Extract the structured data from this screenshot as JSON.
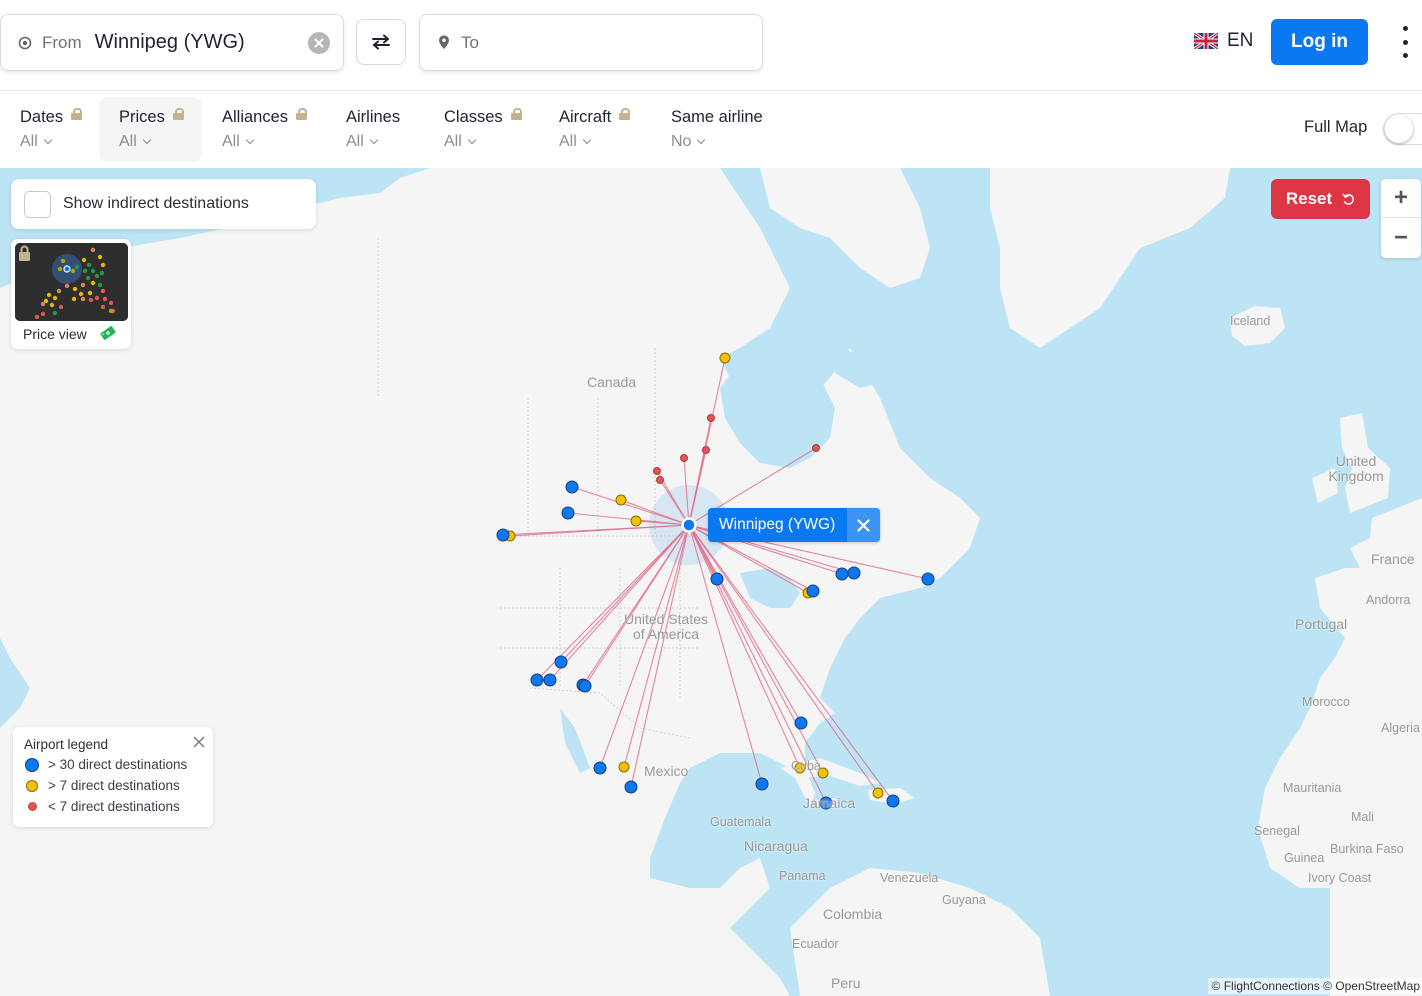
{
  "search": {
    "from_label": "From",
    "from_value": "Winnipeg (YWG)",
    "to_placeholder": "To"
  },
  "header": {
    "language": "EN",
    "login_label": "Log in"
  },
  "filters": [
    {
      "label": "Dates",
      "value": "All",
      "locked": true
    },
    {
      "label": "Prices",
      "value": "All",
      "locked": true,
      "active": true
    },
    {
      "label": "Alliances",
      "value": "All",
      "locked": true
    },
    {
      "label": "Airlines",
      "value": "All",
      "locked": false
    },
    {
      "label": "Classes",
      "value": "All",
      "locked": true
    },
    {
      "label": "Aircraft",
      "value": "All",
      "locked": true
    },
    {
      "label": "Same airline",
      "value": "No",
      "locked": false
    }
  ],
  "full_map": {
    "label": "Full Map",
    "enabled": false
  },
  "map": {
    "indirect_label": "Show indirect destinations",
    "indirect_checked": false,
    "price_view_label": "Price view",
    "reset_label": "Reset",
    "zoom_in": "+",
    "zoom_out": "−",
    "selected_airport": "Winnipeg (YWG)",
    "attribution": "© FlightConnections © OpenStreetMap",
    "country_labels": [
      "Canada",
      "United States of America",
      "Mexico",
      "Cuba",
      "Jamaica",
      "Guatemala",
      "Nicaragua",
      "Panama",
      "Venezuela",
      "Guyana",
      "Colombia",
      "Ecuador",
      "Peru",
      "Iceland",
      "United Kingdom",
      "France",
      "Andorra",
      "Portugal",
      "Morocco",
      "Algeria",
      "Mauritania",
      "Mali",
      "Senegal",
      "Burkina Faso",
      "Guinea",
      "Ivory Coast"
    ]
  },
  "legend": {
    "title": "Airport legend",
    "items": [
      {
        "label": "> 30 direct destinations",
        "color": "#0a78f0",
        "size": "large"
      },
      {
        "label": "> 7 direct destinations",
        "color": "#f5c000",
        "size": "medium"
      },
      {
        "label": "< 7 direct destinations",
        "color": "#e05555",
        "size": "small"
      }
    ]
  },
  "colors": {
    "accent": "#0a78f0",
    "reset": "#dc3545",
    "route_line": "#e0708a",
    "water": "#bde4f4",
    "land": "#f5f5f5"
  },
  "destinations": [
    {
      "type": "large"
    },
    {
      "type": "large"
    },
    {
      "type": "large"
    },
    {
      "type": "medium"
    },
    {
      "type": "medium"
    },
    {
      "type": "medium"
    },
    {
      "type": "small"
    },
    {
      "type": "small"
    },
    {
      "type": "small"
    },
    {
      "type": "small"
    },
    {
      "type": "small"
    },
    {
      "type": "small"
    },
    {
      "type": "medium"
    },
    {
      "type": "large"
    },
    {
      "type": "large"
    },
    {
      "type": "large"
    },
    {
      "type": "large"
    },
    {
      "type": "medium"
    },
    {
      "type": "large"
    },
    {
      "type": "large"
    },
    {
      "type": "large"
    },
    {
      "type": "large"
    },
    {
      "type": "large"
    },
    {
      "type": "large"
    },
    {
      "type": "large"
    },
    {
      "type": "medium"
    },
    {
      "type": "large"
    },
    {
      "type": "large"
    },
    {
      "type": "large"
    },
    {
      "type": "medium"
    },
    {
      "type": "medium"
    },
    {
      "type": "large"
    },
    {
      "type": "medium"
    },
    {
      "type": "large"
    }
  ]
}
